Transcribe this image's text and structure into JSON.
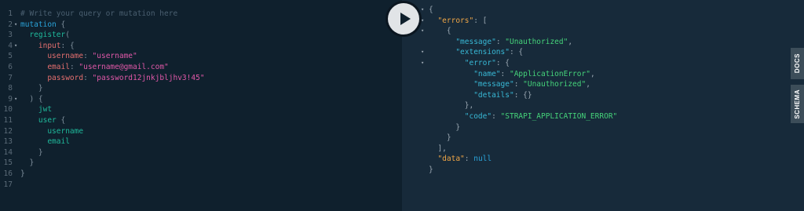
{
  "editor": {
    "lines": [
      {
        "n": "1",
        "fold": false,
        "tokens": [
          {
            "c": "t-comment",
            "t": "# Write your query or mutation here"
          }
        ]
      },
      {
        "n": "2",
        "fold": true,
        "tokens": [
          {
            "c": "t-kw",
            "t": "mutation"
          },
          {
            "c": "t-punc",
            "t": " {"
          }
        ]
      },
      {
        "n": "3",
        "fold": false,
        "tokens": [
          {
            "c": "t-punc",
            "t": "  "
          },
          {
            "c": "t-field",
            "t": "register"
          },
          {
            "c": "t-punc",
            "t": "("
          }
        ]
      },
      {
        "n": "4",
        "fold": true,
        "tokens": [
          {
            "c": "t-punc",
            "t": "    "
          },
          {
            "c": "t-arg",
            "t": "input"
          },
          {
            "c": "t-punc",
            "t": ": {"
          }
        ]
      },
      {
        "n": "5",
        "fold": false,
        "tokens": [
          {
            "c": "t-punc",
            "t": "      "
          },
          {
            "c": "t-arg",
            "t": "username"
          },
          {
            "c": "t-punc",
            "t": ": "
          },
          {
            "c": "t-str",
            "t": "\"username\""
          }
        ]
      },
      {
        "n": "6",
        "fold": false,
        "tokens": [
          {
            "c": "t-punc",
            "t": "      "
          },
          {
            "c": "t-arg",
            "t": "email"
          },
          {
            "c": "t-punc",
            "t": ": "
          },
          {
            "c": "t-str",
            "t": "\"username@gmail.com\""
          }
        ]
      },
      {
        "n": "7",
        "fold": false,
        "tokens": [
          {
            "c": "t-punc",
            "t": "      "
          },
          {
            "c": "t-arg",
            "t": "password"
          },
          {
            "c": "t-punc",
            "t": ": "
          },
          {
            "c": "t-str",
            "t": "\"password12jnkjbljhv3!45\""
          }
        ]
      },
      {
        "n": "8",
        "fold": false,
        "tokens": [
          {
            "c": "t-punc",
            "t": "    }"
          }
        ]
      },
      {
        "n": "9",
        "fold": true,
        "tokens": [
          {
            "c": "t-punc",
            "t": "  ) {"
          }
        ]
      },
      {
        "n": "10",
        "fold": false,
        "tokens": [
          {
            "c": "t-punc",
            "t": "    "
          },
          {
            "c": "t-field",
            "t": "jwt"
          }
        ]
      },
      {
        "n": "11",
        "fold": false,
        "tokens": [
          {
            "c": "t-punc",
            "t": "    "
          },
          {
            "c": "t-field",
            "t": "user"
          },
          {
            "c": "t-punc",
            "t": " {"
          }
        ]
      },
      {
        "n": "12",
        "fold": false,
        "tokens": [
          {
            "c": "t-punc",
            "t": "      "
          },
          {
            "c": "t-field",
            "t": "username"
          }
        ]
      },
      {
        "n": "13",
        "fold": false,
        "tokens": [
          {
            "c": "t-punc",
            "t": "      "
          },
          {
            "c": "t-field",
            "t": "email"
          }
        ]
      },
      {
        "n": "14",
        "fold": false,
        "tokens": [
          {
            "c": "t-punc",
            "t": "    }"
          }
        ]
      },
      {
        "n": "15",
        "fold": false,
        "tokens": [
          {
            "c": "t-punc",
            "t": "  }"
          }
        ]
      },
      {
        "n": "16",
        "fold": false,
        "tokens": [
          {
            "c": "t-punc",
            "t": "}"
          }
        ]
      },
      {
        "n": "17",
        "fold": false,
        "tokens": []
      }
    ]
  },
  "result": {
    "lines": [
      {
        "fold": true,
        "tokens": [
          {
            "c": "r-punc",
            "t": "{"
          }
        ]
      },
      {
        "fold": true,
        "tokens": [
          {
            "c": "r-punc",
            "t": "  "
          },
          {
            "c": "r-key",
            "t": "\"errors\""
          },
          {
            "c": "r-punc",
            "t": ": ["
          }
        ]
      },
      {
        "fold": true,
        "tokens": [
          {
            "c": "r-punc",
            "t": "    {"
          }
        ]
      },
      {
        "fold": false,
        "tokens": [
          {
            "c": "r-punc",
            "t": "      "
          },
          {
            "c": "r-key2",
            "t": "\"message\""
          },
          {
            "c": "r-punc",
            "t": ": "
          },
          {
            "c": "r-str",
            "t": "\"Unauthorized\""
          },
          {
            "c": "r-punc",
            "t": ","
          }
        ]
      },
      {
        "fold": true,
        "tokens": [
          {
            "c": "r-punc",
            "t": "      "
          },
          {
            "c": "r-key2",
            "t": "\"extensions\""
          },
          {
            "c": "r-punc",
            "t": ": {"
          }
        ]
      },
      {
        "fold": true,
        "tokens": [
          {
            "c": "r-punc",
            "t": "        "
          },
          {
            "c": "r-key2",
            "t": "\"error\""
          },
          {
            "c": "r-punc",
            "t": ": {"
          }
        ]
      },
      {
        "fold": false,
        "tokens": [
          {
            "c": "r-punc",
            "t": "          "
          },
          {
            "c": "r-key2",
            "t": "\"name\""
          },
          {
            "c": "r-punc",
            "t": ": "
          },
          {
            "c": "r-str",
            "t": "\"ApplicationError\""
          },
          {
            "c": "r-punc",
            "t": ","
          }
        ]
      },
      {
        "fold": false,
        "tokens": [
          {
            "c": "r-punc",
            "t": "          "
          },
          {
            "c": "r-key2",
            "t": "\"message\""
          },
          {
            "c": "r-punc",
            "t": ": "
          },
          {
            "c": "r-str",
            "t": "\"Unauthorized\""
          },
          {
            "c": "r-punc",
            "t": ","
          }
        ]
      },
      {
        "fold": false,
        "tokens": [
          {
            "c": "r-punc",
            "t": "          "
          },
          {
            "c": "r-key2",
            "t": "\"details\""
          },
          {
            "c": "r-punc",
            "t": ": {}"
          }
        ]
      },
      {
        "fold": false,
        "tokens": [
          {
            "c": "r-punc",
            "t": "        },"
          }
        ]
      },
      {
        "fold": false,
        "tokens": [
          {
            "c": "r-punc",
            "t": "        "
          },
          {
            "c": "r-key2",
            "t": "\"code\""
          },
          {
            "c": "r-punc",
            "t": ": "
          },
          {
            "c": "r-str",
            "t": "\"STRAPI_APPLICATION_ERROR\""
          }
        ]
      },
      {
        "fold": false,
        "tokens": [
          {
            "c": "r-punc",
            "t": "      }"
          }
        ]
      },
      {
        "fold": false,
        "tokens": [
          {
            "c": "r-punc",
            "t": "    }"
          }
        ]
      },
      {
        "fold": false,
        "tokens": [
          {
            "c": "r-punc",
            "t": "  ],"
          }
        ]
      },
      {
        "fold": false,
        "tokens": [
          {
            "c": "r-punc",
            "t": "  "
          },
          {
            "c": "r-key",
            "t": "\"data\""
          },
          {
            "c": "r-punc",
            "t": ": "
          },
          {
            "c": "r-null",
            "t": "null"
          }
        ]
      },
      {
        "fold": false,
        "tokens": [
          {
            "c": "r-punc",
            "t": "}"
          }
        ]
      }
    ]
  },
  "toolbar": {
    "execute_icon": "play-icon"
  },
  "sidetabs": {
    "docs_label": "DOCS",
    "schema_label": "SCHEMA"
  }
}
